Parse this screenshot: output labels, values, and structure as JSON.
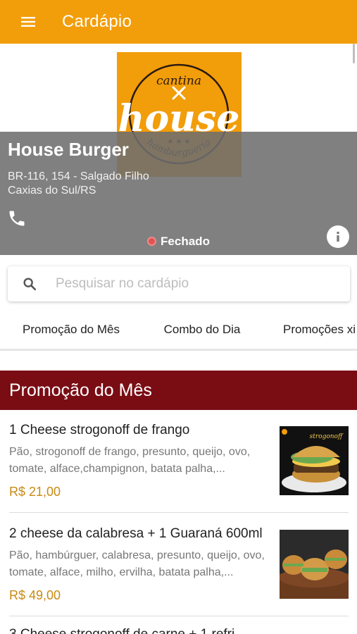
{
  "appbar": {
    "title": "Cardápio",
    "menu_icon": "hamburger-menu-icon"
  },
  "store": {
    "name": "House Burger",
    "address_line1": "BR-116, 154 - Salgado Filho",
    "address_line2": "Caxias do Sul/RS",
    "status": "Fechado",
    "status_color": "#e05353",
    "logo": {
      "top_word": "cantina",
      "main_word": "house",
      "bottom_word": "hamburgueria",
      "bg_color": "#f29d0a"
    }
  },
  "search": {
    "placeholder": "Pesquisar no cardápio",
    "value": ""
  },
  "tabs": [
    {
      "label": "Promoção do Mês",
      "active": true
    },
    {
      "label": "Combo do Dia",
      "active": false
    },
    {
      "label": "Promoções xi",
      "active": false
    }
  ],
  "section": {
    "title": "Promoção do Mês",
    "color": "#7a0d14"
  },
  "items": [
    {
      "title": "1 Cheese strogonoff de frango",
      "description": "Pão, strogonoff de frango, presunto, queijo, ovo, tomate, alface,champignon, batata palha,...",
      "price": "R$ 21,00",
      "image_text": "strogonoff"
    },
    {
      "title": "2 cheese da calabresa + 1 Guaraná 600ml",
      "description": "Pão, hambúrguer, calabresa, presunto, queijo, ovo, tomate, alface, milho, ervilha, batata palha,...",
      "price": "R$ 49,00"
    }
  ],
  "partial_item": {
    "title": "3 Cheese strogonoff de carne + 1 refri"
  },
  "colors": {
    "accent": "#f29d0a",
    "price": "#c98a14",
    "tab_indicator": "#4a1d6b"
  }
}
